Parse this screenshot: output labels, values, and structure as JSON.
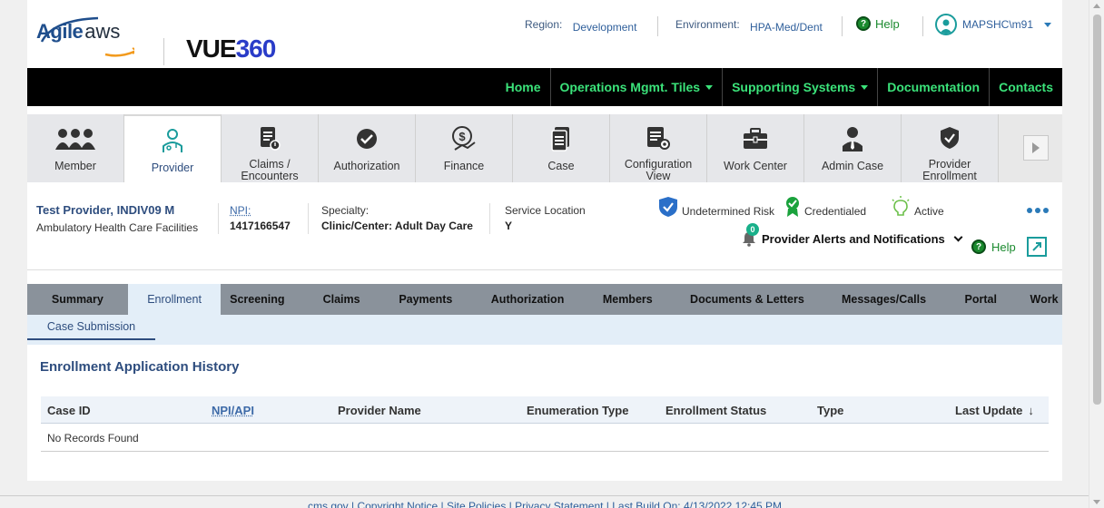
{
  "header": {
    "logo_agile": "Agile",
    "logo_aws": "aws",
    "logo_vue": "VUE",
    "logo_360": "360",
    "region_label": "Region:",
    "region_value": "Development",
    "environment_label": "Environment:",
    "environment_value": "HPA-Med/Dent",
    "help_label": "Help",
    "user_name": "MAPSHC\\m91"
  },
  "nav": {
    "items": [
      {
        "label": "Home",
        "dropdown": false
      },
      {
        "label": "Operations Mgmt. Tiles",
        "dropdown": true
      },
      {
        "label": "Supporting Systems",
        "dropdown": true
      },
      {
        "label": "Documentation",
        "dropdown": false
      },
      {
        "label": "Contacts",
        "dropdown": false
      }
    ]
  },
  "tiles": [
    {
      "label": "Member",
      "icon": "members-icon"
    },
    {
      "label": "Provider",
      "icon": "provider-icon",
      "active": true
    },
    {
      "label": "Claims /\nEncounters",
      "icon": "claims-icon"
    },
    {
      "label": "Authorization",
      "icon": "authorization-icon"
    },
    {
      "label": "Finance",
      "icon": "finance-icon"
    },
    {
      "label": "Case",
      "icon": "case-icon"
    },
    {
      "label": "Configuration\nView",
      "icon": "configuration-icon"
    },
    {
      "label": "Work Center",
      "icon": "briefcase-icon"
    },
    {
      "label": "Admin Case",
      "icon": "admin-icon"
    },
    {
      "label": "Provider\nEnrollment",
      "icon": "shield-check-icon"
    }
  ],
  "provider": {
    "name": "Test Provider, INDIV09 M",
    "type": "Ambulatory Health Care Facilities",
    "npi_label": "NPI:",
    "npi_value": "1417166547",
    "specialty_label": "Specialty:",
    "specialty_value": "Clinic/Center: Adult Day Care",
    "location_label": "Service Location",
    "location_value": "Y",
    "risk": "Undetermined Risk",
    "credential": "Credentialed",
    "status": "Active",
    "alerts_label": "Provider Alerts and Notifications",
    "alerts_count": "0",
    "help_label": "Help"
  },
  "tabs": [
    {
      "label": "Summary",
      "width": 111
    },
    {
      "label": "Enrollment",
      "width": 103,
      "active": true
    },
    {
      "label": "Screening",
      "width": 80
    },
    {
      "label": "Claims",
      "width": 106
    },
    {
      "label": "Payments",
      "width": 80
    },
    {
      "label": "Authorization",
      "width": 145
    },
    {
      "label": "Members",
      "width": 76
    },
    {
      "label": "Documents & Letters",
      "width": 188
    },
    {
      "label": "Messages/Calls",
      "width": 114
    },
    {
      "label": "Portal",
      "width": 100
    },
    {
      "label": "Work",
      "width": 40
    }
  ],
  "subtab": "Case Submission",
  "section_title": "Enrollment Application History",
  "table": {
    "columns": [
      "Case ID",
      "NPI/API",
      "Provider Name",
      "Enumeration Type",
      "Enrollment Status",
      "Type",
      "Last Update"
    ],
    "empty": "No Records Found",
    "sort_indicator": "↓"
  },
  "footer": "cms.gov | Copyright Notice | Site Policies | Privacy Statement | Last Build On: 4/13/2022 12:45 PM",
  "colors": {
    "nav_text": "#3be37a",
    "brand_blue": "#2e4d7e",
    "help_green": "#1a8a2e"
  }
}
